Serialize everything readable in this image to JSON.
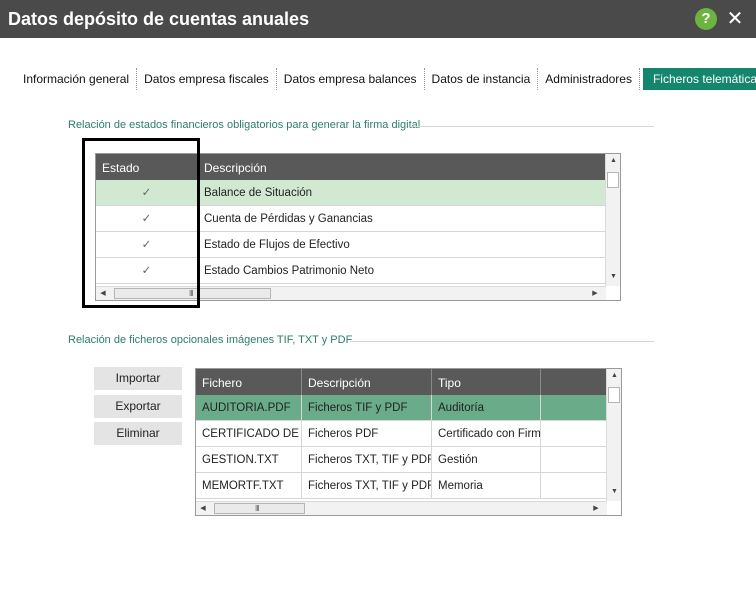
{
  "window": {
    "title": "Datos depósito de cuentas anuales",
    "help_icon_glyph": "?",
    "close_icon_glyph": "✕",
    "help_color": "#6cb33f"
  },
  "tabs": [
    {
      "label": "Información general"
    },
    {
      "label": "Datos empresa fiscales"
    },
    {
      "label": "Datos empresa balances"
    },
    {
      "label": "Datos de instancia"
    },
    {
      "label": "Administradores"
    },
    {
      "label": "Ficheros telemática"
    }
  ],
  "colors": {
    "accent": "#14866d",
    "header": "#595959",
    "selected_light": "#d2e9d1",
    "selected_dark": "#6aab89"
  },
  "section1": {
    "label": "Relación de estados financieros obligatorios para generar la firma digital",
    "columns": [
      "Estado",
      "Descripción"
    ],
    "rows": [
      {
        "check": "✓",
        "desc": "Balance de Situación"
      },
      {
        "check": "✓",
        "desc": "Cuenta de Pérdidas y Ganancias"
      },
      {
        "check": "✓",
        "desc": "Estado de Flujos de Efectivo"
      },
      {
        "check": "✓",
        "desc": "Estado Cambios Patrimonio Neto"
      }
    ]
  },
  "section2": {
    "label": "Relación de ficheros opcionales imágenes TIF, TXT y PDF",
    "buttons": {
      "import": "Importar",
      "export": "Exportar",
      "delete": "Eliminar"
    },
    "columns": [
      "Fichero",
      "Descripción",
      "Tipo"
    ],
    "rows": [
      {
        "file": "AUDITORIA.PDF",
        "desc": "Ficheros TIF y PDF",
        "type": "Auditoría"
      },
      {
        "file": "CERTIFICADO DE",
        "desc": "Ficheros PDF",
        "type": "Certificado con Firma"
      },
      {
        "file": "GESTION.TXT",
        "desc": "Ficheros TXT, TIF y PDF",
        "type": "Gestión"
      },
      {
        "file": "MEMORTF.TXT",
        "desc": "Ficheros TXT, TIF y PDF",
        "type": "Memoria"
      }
    ]
  },
  "scroll": {
    "up": "▲",
    "down": "▼",
    "left": "◀",
    "right": "▶",
    "grip": "III"
  }
}
